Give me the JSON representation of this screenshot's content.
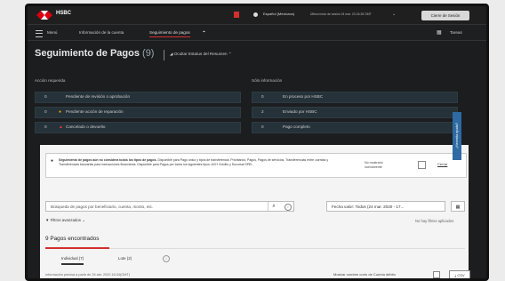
{
  "header": {
    "brand": "HSBC",
    "language": "Español (Mexicano)",
    "last_login": "Último inicio de sesión 24 mar. 23 16:28 GMT",
    "logout": "Cierre de Sesión"
  },
  "nav": {
    "menu": "Menú",
    "account_info": "Información de la cuenta",
    "payment_tracking": "Seguimiento de pagos",
    "tasks": "Tareas"
  },
  "page": {
    "title": "Seguimiento de Pagos",
    "count": "(9)",
    "summary_toggle": "Ocultar Estatus del Resumen"
  },
  "action_required": {
    "heading": "Acción requerida",
    "rows": [
      {
        "value": "0",
        "label": "Pendiente de revisión o aprobación",
        "icon": ""
      },
      {
        "value": "0",
        "label": "Pendiente acción de reparación",
        "icon": "warning-circle"
      },
      {
        "value": "0",
        "label": "Cancelado o devuelto",
        "icon": "alert-triangle"
      }
    ]
  },
  "info_only": {
    "heading": "Sólo información",
    "rows": [
      {
        "value": "0",
        "label": "En proceso por HSBC"
      },
      {
        "value": "2",
        "label": "Enviado por HSBC"
      },
      {
        "value": "0",
        "label": "Pago completo"
      }
    ]
  },
  "notice": {
    "bold": "Seguimiento de pagos aún no considera todos los tipos de pagos.",
    "text": " Disponible para Pago único y tipos de transferencia: Prioritarios, Pagos, Pagos de servicios, Transferencias entre cuentas y Transferencias bancarias para instrucciones financieras. Disponible para Pagos por todos los siguientes tipos: ACH Crédito y Sucursal SPEI.",
    "dont_show": "No mostrarlo nuevamente",
    "close": "Cerrar"
  },
  "filters": {
    "search_placeholder": "Búsqueda de pagos por beneficiario, cuenta, monto, etc.",
    "date_value": "Fecha valor: Todos (24 mar. 2020 - 17...",
    "advanced": "Filtros avanzados",
    "no_filters": "No hay filtros aplicados"
  },
  "results": {
    "found": "9 Pagos encontrados",
    "tab_individual": "Individual (7)",
    "tab_batch": "Lote (2)",
    "info_date": "Información precisa a partir de 26 abr. 2020 16:34(GMT)",
    "short_name": "Mostrar nombre corto de Cuenta débito",
    "csv": "CSV"
  },
  "side": {
    "help": "¿Necesita ayuda?"
  }
}
